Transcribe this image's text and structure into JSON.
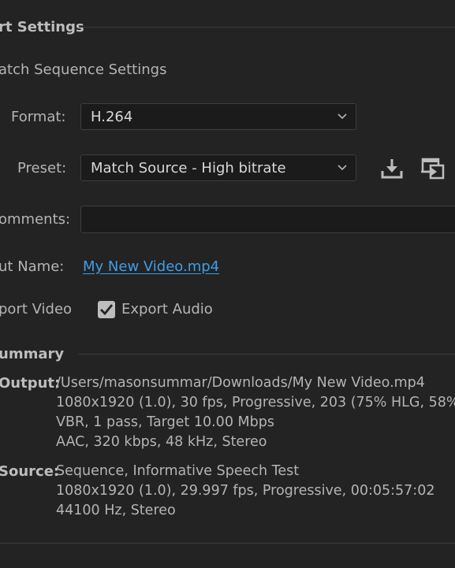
{
  "export_settings": {
    "title": "rt Settings",
    "match_sequence_label": "atch Sequence Settings"
  },
  "format": {
    "label": "Format:",
    "value": "H.264"
  },
  "preset": {
    "label": "Preset:",
    "value": "Match Source - High bitrate"
  },
  "comments": {
    "label": "omments:",
    "value": ""
  },
  "output_name": {
    "label": "ut Name:",
    "value": "My New Video.mp4"
  },
  "export_video": {
    "label": "port Video"
  },
  "export_audio": {
    "label": "Export Audio",
    "checked": true
  },
  "summary": {
    "title": "ummary",
    "output": {
      "key": "Output:",
      "lines": [
        "/Users/masonsummar/Downloads/My New Video.mp4",
        "1080x1920 (1.0), 30 fps, Progressive, 203 (75% HLG, 58%",
        "VBR, 1 pass, Target 10.00 Mbps",
        "AAC, 320 kbps, 48 kHz, Stereo"
      ]
    },
    "source": {
      "key": "Source:",
      "lines": [
        "Sequence, Informative Speech Test",
        "1080x1920 (1.0), 29.997 fps, Progressive, 00:05:57:02",
        "44100 Hz, Stereo"
      ]
    }
  },
  "icons": {
    "save_preset": "download-icon",
    "import_preset": "import-preset-icon"
  }
}
